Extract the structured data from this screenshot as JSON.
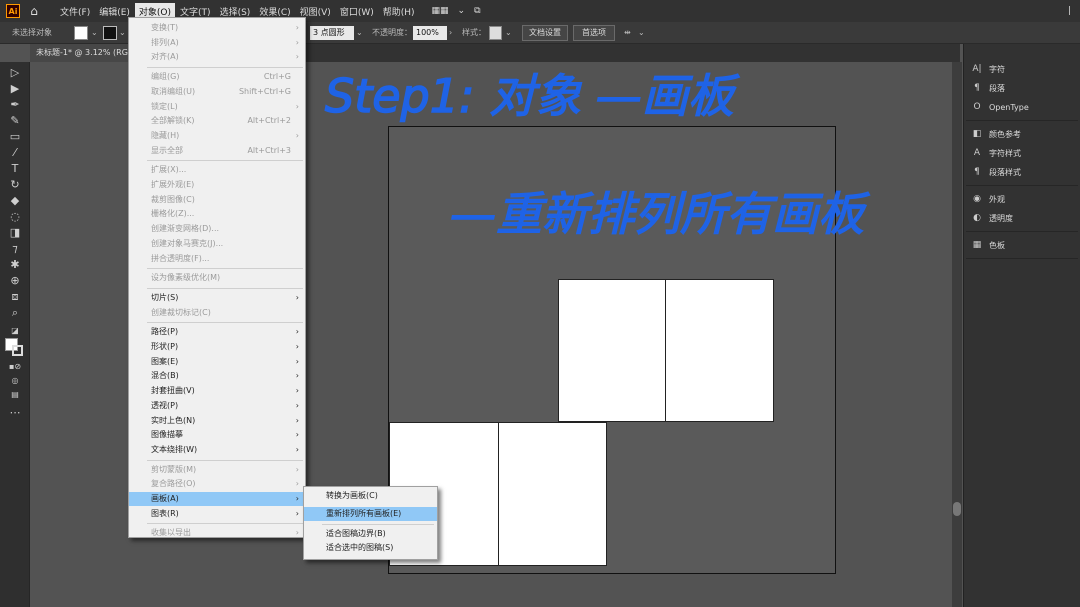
{
  "app": {
    "logo": "Ai"
  },
  "menubar": {
    "items": [
      "文件(F)",
      "编辑(E)",
      "对象(O)",
      "文字(T)",
      "选择(S)",
      "效果(C)",
      "视图(V)",
      "窗口(W)",
      "帮助(H)"
    ],
    "workspace": "▦▦",
    "right_text": "|"
  },
  "control_bar": {
    "no_selection": "未选择对象",
    "stroke_style": "3 点圆形",
    "opacity_label": "不透明度：",
    "opacity_value": "100%",
    "style_label": "样式：",
    "doc_settings": "文档设置",
    "preferences": "首选项"
  },
  "document_tab": {
    "label": "未标题-1* @ 3.12% (RG"
  },
  "object_menu": {
    "items": [
      {
        "label": "变换(T)",
        "shortcut": "",
        "submenu": true,
        "disabled": true
      },
      {
        "label": "排列(A)",
        "shortcut": "",
        "submenu": true,
        "disabled": true
      },
      {
        "label": "对齐(A)",
        "shortcut": "",
        "submenu": true,
        "disabled": true
      },
      {
        "sep": true
      },
      {
        "label": "编组(G)",
        "shortcut": "Ctrl+G",
        "disabled": true
      },
      {
        "label": "取消编组(U)",
        "shortcut": "Shift+Ctrl+G",
        "disabled": true
      },
      {
        "label": "锁定(L)",
        "shortcut": "",
        "submenu": true,
        "disabled": true
      },
      {
        "label": "全部解锁(K)",
        "shortcut": "Alt+Ctrl+2",
        "disabled": true
      },
      {
        "label": "隐藏(H)",
        "shortcut": "",
        "submenu": true,
        "disabled": true
      },
      {
        "label": "显示全部",
        "shortcut": "Alt+Ctrl+3",
        "disabled": true
      },
      {
        "sep": true
      },
      {
        "label": "扩展(X)...",
        "shortcut": "",
        "disabled": true
      },
      {
        "label": "扩展外观(E)",
        "shortcut": "",
        "disabled": true
      },
      {
        "label": "裁剪图像(C)",
        "shortcut": "",
        "disabled": true
      },
      {
        "label": "栅格化(Z)...",
        "shortcut": "",
        "disabled": true
      },
      {
        "label": "创建渐变网格(D)...",
        "shortcut": "",
        "disabled": true
      },
      {
        "label": "创建对象马赛克(J)...",
        "shortcut": "",
        "disabled": true
      },
      {
        "label": "拼合透明度(F)...",
        "shortcut": "",
        "disabled": true
      },
      {
        "sep": true
      },
      {
        "label": "设为像素级优化(M)",
        "shortcut": "",
        "disabled": true
      },
      {
        "sep": true
      },
      {
        "label": "切片(S)",
        "shortcut": "",
        "submenu": true,
        "disabled": false
      },
      {
        "label": "创建裁切标记(C)",
        "shortcut": "",
        "disabled": true
      },
      {
        "sep": true
      },
      {
        "label": "路径(P)",
        "shortcut": "",
        "submenu": true,
        "disabled": false
      },
      {
        "label": "形状(P)",
        "shortcut": "",
        "submenu": true,
        "disabled": false
      },
      {
        "label": "图案(E)",
        "shortcut": "",
        "submenu": true,
        "disabled": false
      },
      {
        "label": "混合(B)",
        "shortcut": "",
        "submenu": true,
        "disabled": false
      },
      {
        "label": "封套扭曲(V)",
        "shortcut": "",
        "submenu": true,
        "disabled": false
      },
      {
        "label": "透视(P)",
        "shortcut": "",
        "submenu": true,
        "disabled": false
      },
      {
        "label": "实时上色(N)",
        "shortcut": "",
        "submenu": true,
        "disabled": false
      },
      {
        "label": "图像描摹",
        "shortcut": "",
        "submenu": true,
        "disabled": false
      },
      {
        "label": "文本绕排(W)",
        "shortcut": "",
        "submenu": true,
        "disabled": false
      },
      {
        "sep": true
      },
      {
        "label": "剪切蒙版(M)",
        "shortcut": "",
        "submenu": true,
        "disabled": true
      },
      {
        "label": "复合路径(O)",
        "shortcut": "",
        "submenu": true,
        "disabled": true
      },
      {
        "label": "画板(A)",
        "shortcut": "",
        "submenu": true,
        "disabled": false,
        "highlight": true
      },
      {
        "label": "图表(R)",
        "shortcut": "",
        "submenu": true,
        "disabled": false
      },
      {
        "sep": true
      },
      {
        "label": "收集以导出",
        "shortcut": "",
        "submenu": true,
        "disabled": true
      }
    ]
  },
  "artboard_submenu": {
    "items": [
      {
        "label": "转换为画板(C)",
        "highlight": false
      },
      {
        "label": "重新排列所有画板(E)",
        "highlight": true
      },
      {
        "label": "适合图稿边界(B)",
        "highlight": false
      },
      {
        "label": "适合选中的图稿(S)",
        "highlight": false
      }
    ]
  },
  "right_panel": {
    "groups": [
      [
        {
          "icon": "A|",
          "label": "字符"
        },
        {
          "icon": "¶",
          "label": "段落"
        },
        {
          "icon": "O",
          "label": "OpenType"
        }
      ],
      [
        {
          "icon": "◧",
          "label": "颜色参考"
        },
        {
          "icon": "A",
          "label": "字符样式"
        },
        {
          "icon": "¶",
          "label": "段落样式"
        }
      ],
      [
        {
          "icon": "◉",
          "label": "外观"
        },
        {
          "icon": "◐",
          "label": "透明度"
        }
      ],
      [
        {
          "icon": "▦",
          "label": "色板"
        }
      ]
    ]
  },
  "annotation": {
    "line1": "Step1: 对象 —画板",
    "line2": "—重新排列所有画板"
  },
  "colors": {
    "annotation": "#1f63e6",
    "menu_highlight": "#90c8f6",
    "canvas": "#535353"
  }
}
